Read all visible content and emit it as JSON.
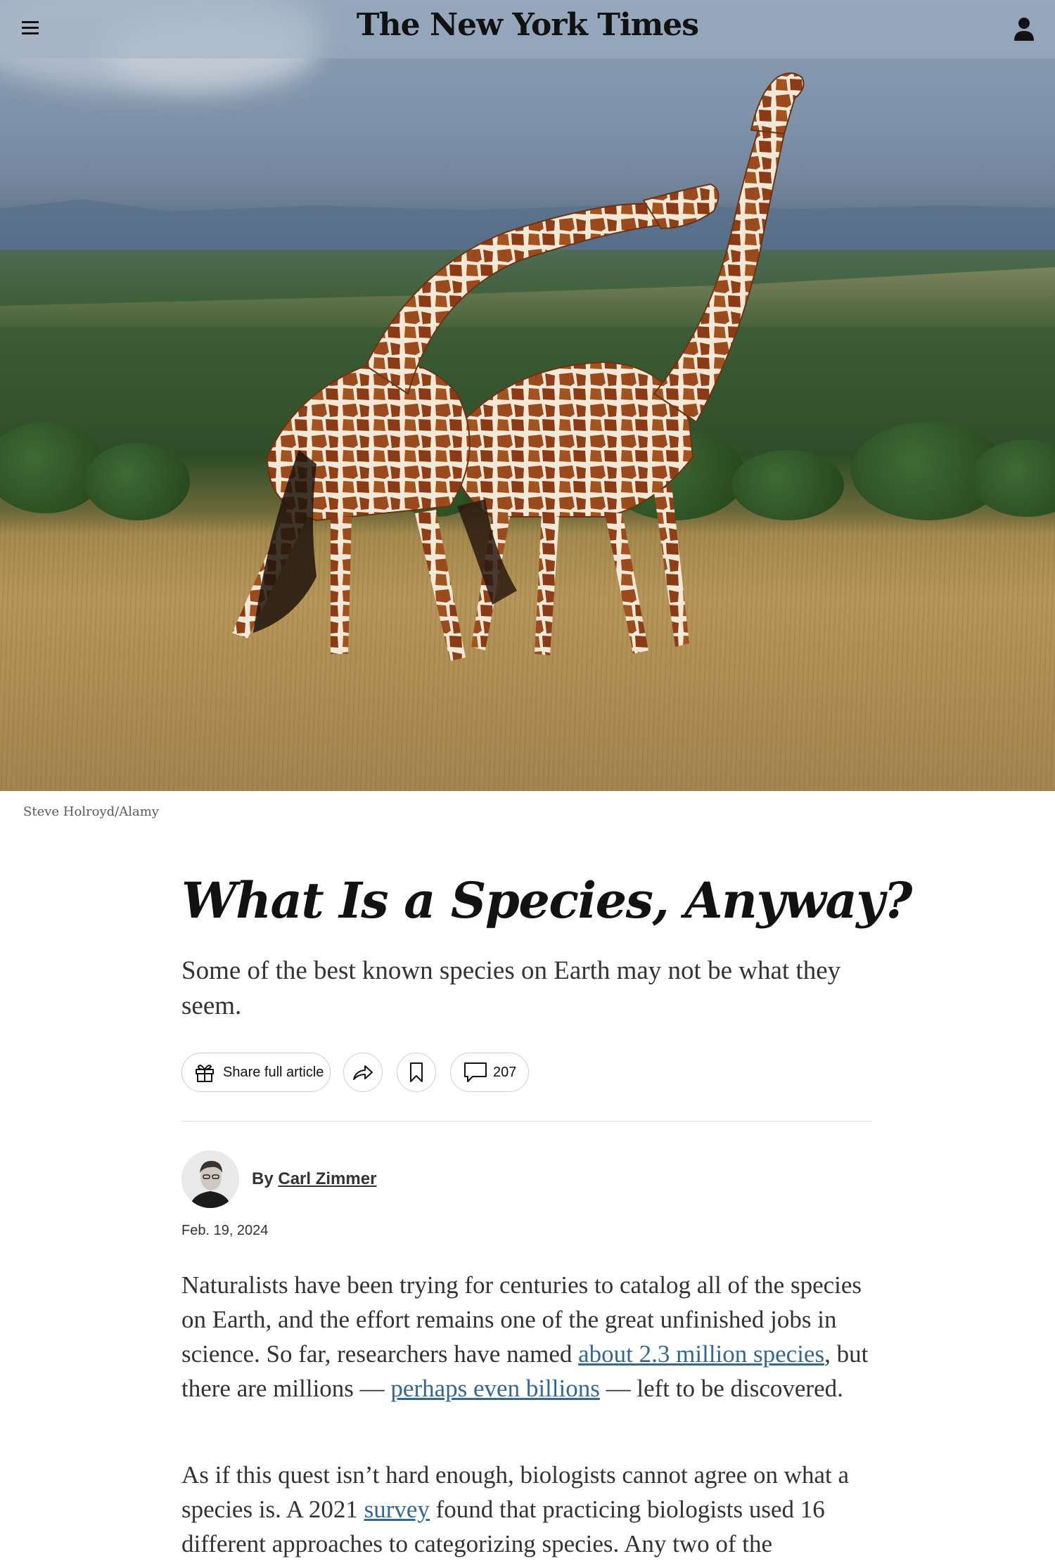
{
  "masthead": {
    "logo_text": "The New York Times",
    "menu_icon": "hamburger-menu-icon",
    "account_icon": "user-account-icon"
  },
  "hero": {
    "credit": "Steve Holroyd/Alamy"
  },
  "article": {
    "headline": "What Is a Species, Anyway?",
    "summary": "Some of the best known species on Earth may not be what they seem.",
    "tools": {
      "share_label": "Share full article",
      "share_icon": "gift-icon",
      "forward_icon": "share-arrow-icon",
      "save_icon": "bookmark-icon",
      "comments_icon": "comment-bubble-icon",
      "comment_count": "207"
    },
    "byline_prefix": "By",
    "author": "Carl Zimmer",
    "date": "Feb. 19, 2024",
    "paragraphs": [
      {
        "t1": "Naturalists have been trying for centuries to catalog all of the species on Earth, and the effort remains one of the great unfinished jobs in science. So far, researchers have named ",
        "link1": "about 2.3 million species",
        "t2": ", but there are millions — ",
        "link2": "perhaps even billions",
        "t3": " — left to be discovered."
      },
      {
        "t1": "As if this quest isn’t hard enough, biologists cannot agree on what a species is. A 2021 ",
        "link1": "survey",
        "t2": " found that practicing biologists used 16 different approaches to categorizing species. Any two of the"
      }
    ]
  },
  "colors": {
    "link": "#326891",
    "text": "#333333",
    "headline": "#121212",
    "rule": "#dfdfdf"
  }
}
